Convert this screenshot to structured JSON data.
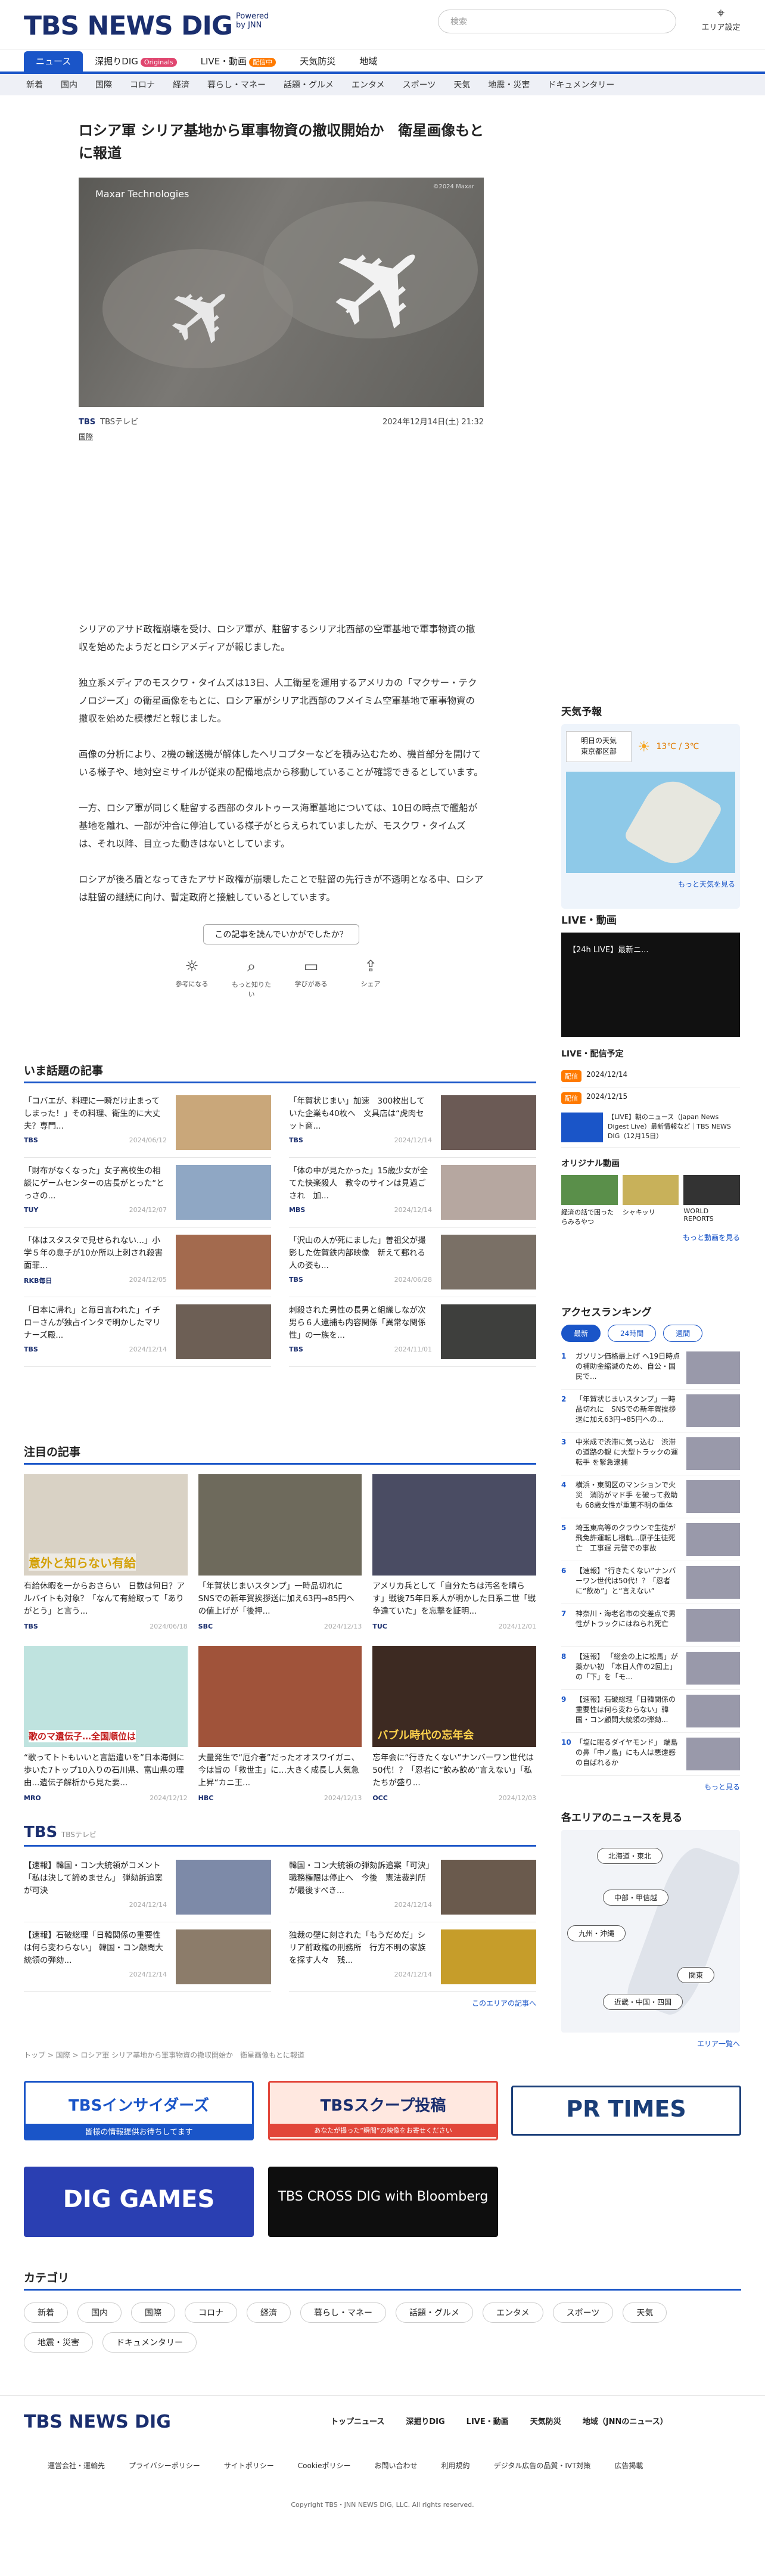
{
  "header": {
    "logo": "TBS NEWS DIG",
    "logo_sub": "Powered by JNN",
    "search_placeholder": "検索",
    "search_icon": "search-icon",
    "area_label": "エリア設定"
  },
  "gnav": [
    "ニュース",
    "深掘りDIG",
    "LIVE・動画",
    "天気防災",
    "地域"
  ],
  "gnav_badges": {
    "orig": "Originals",
    "live": "配信中"
  },
  "subnav": [
    "新着",
    "国内",
    "国際",
    "コロナ",
    "経済",
    "暮らし・マネー",
    "話題・グルメ",
    "エンタメ",
    "スポーツ",
    "天気",
    "地震・災害",
    "ドキュメンタリー"
  ],
  "article": {
    "title": "ロシア軍 シリア基地から軍事物資の撤収開始か　衛星画像もとに報道",
    "img_credit": "Maxar Technologies",
    "img_credit_small": "©2024 Maxar",
    "source": "TBS",
    "source_name": "TBSテレビ",
    "date": "2024年12月14日(土) 21:32",
    "category": "国際",
    "paragraphs": [
      "シリアのアサド政権崩壊を受け、ロシア軍が、駐留するシリア北西部の空軍基地で軍事物資の撤収を始めたようだとロシアメディアが報じました。",
      "独立系メディアのモスクワ・タイムズは13日、人工衛星を運用するアメリカの「マクサー・テクノロジーズ」の衛星画像をもとに、ロシア軍がシリア北西部のフメイミム空軍基地で軍事物資の撤収を始めた模様だと報じました。",
      "画像の分析により、2機の輸送機が解体したヘリコプターなどを積み込むため、機首部分を開けている様子や、地対空ミサイルが従来の配備地点から移動していることが確認できるとしています。",
      "一方、ロシア軍が同じく駐留する西部のタルトゥース海軍基地については、10日の時点で艦船が基地を離れ、一部が沖合に停泊している様子がとらえられていましたが、モスクワ・タイムズは、それ以降、目立った動きはないとしています。",
      "ロシアが後ろ盾となってきたアサド政権が崩壊したことで駐留の先行きが不透明となる中、ロシアは駐留の継続に向け、暫定政府と接触しているとしています。"
    ],
    "feedback_q": "この記事を読んでいかがでしたか？",
    "feedback": [
      "参考になる",
      "もっと知りたい",
      "学びがある",
      "シェア"
    ]
  },
  "trending": {
    "title": "いま話題の記事",
    "items": [
      {
        "text": "「コバエが、料理に一瞬だけ止まってしまった！」その料理、衛生的に大丈夫？専門...",
        "src": "TBS",
        "date": "2024/06/12"
      },
      {
        "text": "「年賀状じまい」加速　300枚出していた企業も40枚へ　文具店は“虎肉セット商...",
        "src": "TBS",
        "date": "2024/12/14"
      },
      {
        "text": "「財布がなくなった」女子高校生の相談にゲームセンターの店長がとった“とっさの...",
        "src": "TUY",
        "date": "2024/12/07"
      },
      {
        "text": "「体の中が見たかった」15歳少女が全てた快楽殺人　教令のサインは見過ごされ　加...",
        "src": "MBS",
        "date": "2024/12/14"
      },
      {
        "text": "「体はスタスタで見せられない...」小学５年の息子が10か所以上刺され殺害　面罪...",
        "src": "RKB毎日",
        "date": "2024/12/05"
      },
      {
        "text": "「沢山の人が死にました」曽祖父が撮影した佐賀鉄内部映像　新えて郵れる人の姿も...",
        "src": "TBS",
        "date": "2024/06/28"
      },
      {
        "text": "「日本に帰れ」と毎日言われた」イチローさんが独占インタで明かしたマリナーズ殿...",
        "src": "TBS",
        "date": "2024/12/14"
      },
      {
        "text": "刺殺された男性の長男と組織しなが次男ら６人逮捕も内容関係「異常な関係性」の一族を...",
        "src": "TBS",
        "date": "2024/11/01"
      }
    ]
  },
  "featured": {
    "title": "注目の記事",
    "items": [
      {
        "text": "有給休暇を一からおさらい　日数は何日？アルバイトも対象？「なんて有給取って「ありがとう」と言う...",
        "src": "TBS",
        "date": "2024/06/18",
        "overlay": "意外と知らない有給"
      },
      {
        "text": "「年賀状じまいスタンプ」一時品切れに　SNSでの新年賀挨拶送に加え63円→85円への値上げが「後押...",
        "src": "SBC",
        "date": "2024/12/13"
      },
      {
        "text": "アメリカ兵として「自分たちは汚名を晴らす」戦後75年日系人が明かした日系二世「戦争違ていた」を忘撃を証明...",
        "src": "TUC",
        "date": "2024/12/01"
      },
      {
        "text": "“歌ってトトもいいと言語遣いを”日本海側に歩いた7トップ10入りの石川県、富山県の理由...遺伝子解析から見た要...",
        "src": "MRO",
        "date": "2024/12/12",
        "overlay": "歌のマ遺伝子…全国順位は"
      },
      {
        "text": "大量発生で“厄介者”だったオオスワイガニ、今は旨の「救世主」に…大きく成長し人気急上昇“カニ王...",
        "src": "HBC",
        "date": "2024/12/13"
      },
      {
        "text": "忘年会に“行きたくない”ナンバーワン世代は50代！？「忍者に“飲み飲め”言えない」「私たちが盛り...",
        "src": "OCC",
        "date": "2024/12/03",
        "overlay": "バブル時代の忘年会"
      }
    ]
  },
  "tbs_section": {
    "title": "TBSテレビ",
    "items": [
      {
        "text": "【速報】韓国・コン大統領がコメント「私は決して諦めません」 弾劾訴追案が可決",
        "date": "2024/12/14"
      },
      {
        "text": "韓国・コン大統領の弾劾訴追案「可決」職務権限は停止へ　今後　憲法裁判所が最後すべき...",
        "date": "2024/12/14"
      },
      {
        "text": "【速報】石破総理「日韓関係の重要性は何ら変わらない」 韓国・コン顧問大統領の弾劾...",
        "date": "2024/12/14"
      },
      {
        "text": "独裁の壁に刻された「もうだめだ」シリア前政権の刑務所　行方不明の家族を探す人々　残...",
        "date": "2024/12/14"
      }
    ],
    "more": "このエリアの記事へ"
  },
  "breadcrumb": "トップ > 国際 > ロシア軍 シリア基地から軍事物資の撤収開始か　衛星画像もとに報道",
  "banners": [
    "TBSインサイダーズ",
    "TBSスクープ投稿",
    "PR TIMES",
    "DIG GAMES",
    "TBS CROSS DIG with Bloomberg"
  ],
  "banner_insider_sub": "皆様の情報提供お待ちしてます",
  "banner_scoop_sub": "あなたが撮った“瞬間”の映像をお寄せください",
  "categories": {
    "title": "カテゴリ",
    "items": [
      "新着",
      "国内",
      "国際",
      "コロナ",
      "経済",
      "暮らし・マネー",
      "話題・グルメ",
      "エンタメ",
      "スポーツ",
      "天気",
      "地震・災害",
      "ドキュメンタリー"
    ]
  },
  "side": {
    "weather": {
      "title": "天気予報",
      "selector_l1": "明日の天気",
      "selector_l2": "東京都区部",
      "temp": "13℃ / 3℃",
      "more": "もっと天気を見る"
    },
    "live": {
      "title": "LIVE・動画",
      "caption": "【24h LIVE】最新ニ...",
      "sched_title": "LIVE・配信予定",
      "sched": [
        {
          "badge": "配信",
          "date": "2024/12/14"
        },
        {
          "badge": "配信",
          "date": "2024/12/15",
          "text": "【LIVE】朝のニュース（Japan News Digest Live）最新情報など｜TBS NEWS DIG（12月15日）"
        }
      ],
      "orig_title": "オリジナル動画",
      "orig": [
        "経済の話で困ったらみるやつ",
        "シャキッリ",
        "WORLD REPORTS"
      ],
      "more": "もっと動画を見る"
    },
    "ranking": {
      "title": "アクセスランキング",
      "tabs": [
        "最新",
        "24時間",
        "週間"
      ],
      "items": [
        "ガソリン価格最上げ へ19日時点の補助金縮減のため、自公・国民で...",
        "「年賀状じまいスタンプ」一時品切れに　SNSでの新年賀挨拶送に加え63円→85円への...",
        "中米成で渋滞に気っ込む　渋滞の道路の観 に大型トラックの運転手 を緊急逮捕",
        "横浜・東関区のマンションで火災　消防がマド手 を破って救助も 68歳女性が重篤不明の重体",
        "埼玉東高等のクラウンで生徒が飛免許運転し梱軌...原子生徒死亡　工事遅 元警での事故",
        "【速報】“行きたくない”ナンバーワン世代は50代！？「忍者に“飲め”」と“言えない”",
        "神奈川・海老名市の交差点で男性がトラックにはねられ死亡",
        "【速報】 「総会の上に松馬」が薬かい初　「本日人件の2回上」の「下」を「モ...",
        "【速報】石破総理「日韓関係の重要性は何ら変わらない」韓国・コン顧問大統領の弾劾...",
        "「塩に眠るダイヤモンド」 端島 の鼻「中ノ島」にも人は悪遠感の自ばれるか"
      ],
      "more": "もっと見る"
    },
    "area": {
      "title": "各エリアのニュースを見る",
      "buttons": [
        "北海道・東北",
        "中部・甲信越",
        "九州・沖縄",
        "関東",
        "近畿・中国・四国"
      ],
      "more": "エリア一覧へ"
    }
  },
  "footer": {
    "logo": "TBS NEWS DIG",
    "links": [
      "トップニュース",
      "深掘りDIG",
      "LIVE・動画",
      "天気防災",
      "地域（JNNのニュース）"
    ],
    "links2": [
      "運営会社・運輸先",
      "プライバシーポリシー",
      "サイトポリシー",
      "Cookieポリシー",
      "お問い合わせ",
      "利用規約",
      "デジタル広告の品質・IVT対策",
      "広告掲載"
    ],
    "copyright": "Copyright TBS・JNN NEWS DIG, LLC. All rights reserved."
  }
}
